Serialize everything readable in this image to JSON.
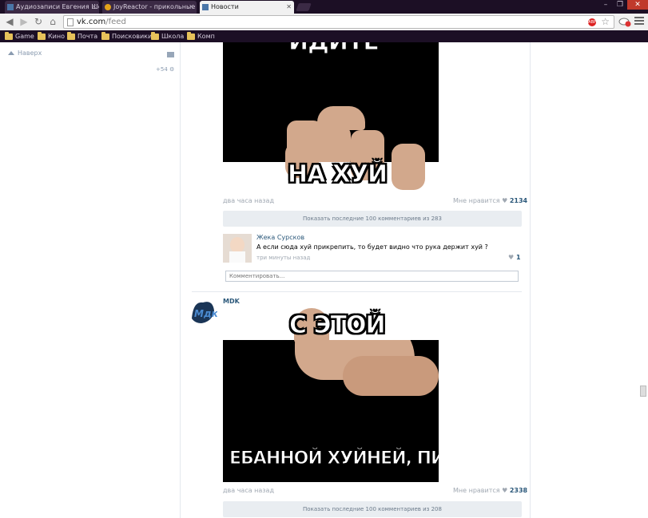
{
  "browser": {
    "tabs": [
      {
        "title": "Аудиозаписи Евгения Ше",
        "active": false
      },
      {
        "title": "JoyReactor - прикольные",
        "active": false
      },
      {
        "title": "Новости",
        "active": true
      }
    ],
    "url_host": "vk.com",
    "url_path": "/feed",
    "adblock_badge": "ABP",
    "bookmarks": [
      "Game",
      "Кино",
      "Почта",
      "Поисковики",
      "Школа",
      "Комп"
    ],
    "window_controls": {
      "minimize": "–",
      "maximize": "❐",
      "close": "✕"
    }
  },
  "sidebar": {
    "upward_label": "Наверх",
    "counter": "+54"
  },
  "post1": {
    "meme_top": "ИДИТЕ",
    "meme_bottom": "НА ХУЙ",
    "time": "два часа назад",
    "likes_label": "Мне нравится",
    "likes_count": "2134",
    "show_comments": "Показать последние 100 комментариев из 283",
    "comment": {
      "author": "Жека Сурсков",
      "text": "А если сюда хуй прикрепить, то будет видно что рука держит хуй ?",
      "time": "три минуты назад",
      "likes": "1"
    },
    "comment_placeholder": "Комментировать..."
  },
  "post2": {
    "author": "MDK",
    "meme_top": "С ЭТОЙ",
    "meme_bottom": "ЕБАННОЙ ХУЙНЕЙ, ПИДОРЫ",
    "time": "два часа назад",
    "likes_label": "Мне нравится",
    "likes_count": "2338",
    "show_comments": "Показать последние 100 комментариев из 208"
  },
  "colors": {
    "chrome_bg": "#1c0f25",
    "link_blue": "#2b587a",
    "meta_gray": "#a0a8b2"
  }
}
